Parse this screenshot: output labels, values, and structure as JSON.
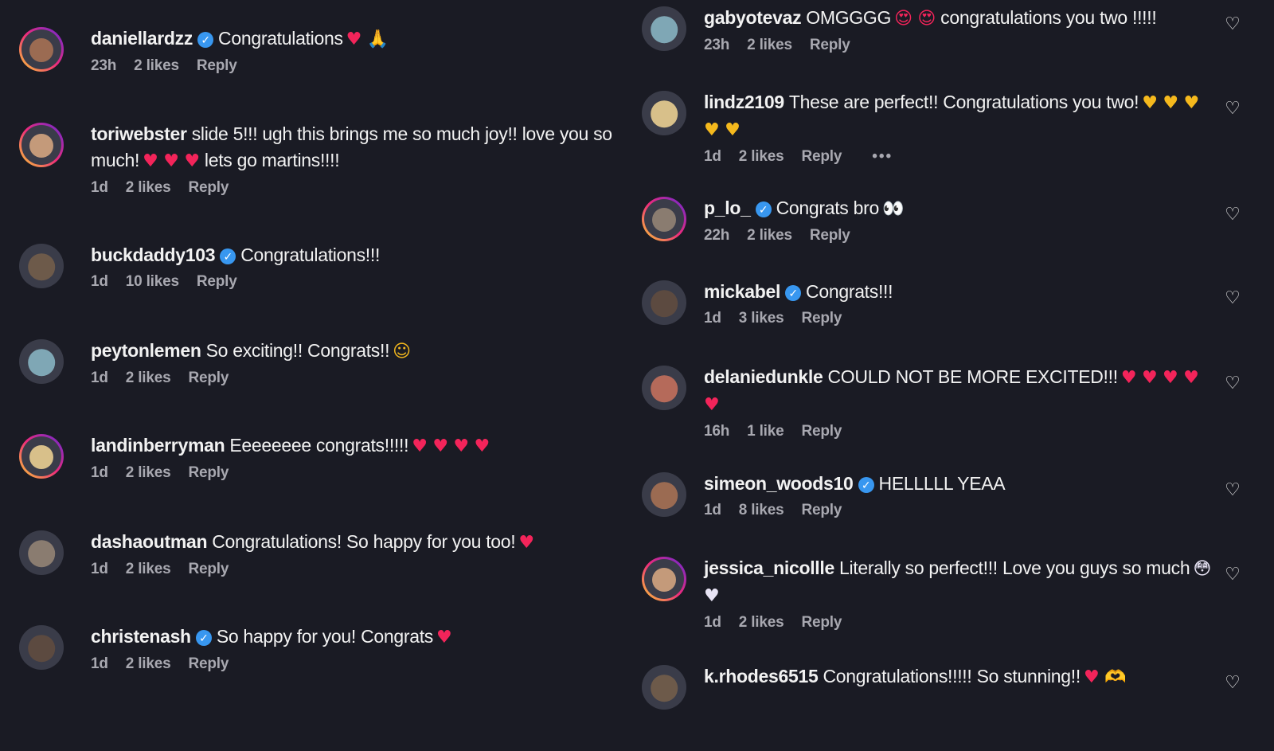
{
  "left": [
    {
      "user": "daniellardzz",
      "verified": true,
      "text": "Congratulations",
      "emoji": "♥ 🙏",
      "emoji_color": "red",
      "time": "23h",
      "likes": "2 likes",
      "reply": "Reply",
      "ring": true
    },
    {
      "user": "toriwebster",
      "verified": false,
      "text": "slide 5!!! ugh this brings me so much joy!! love you so much!",
      "emoji": "♥ ♥ ♥",
      "emoji_color": "red",
      "text2": "lets go martins!!!!",
      "time": "1d",
      "likes": "2 likes",
      "reply": "Reply",
      "ring": true
    },
    {
      "user": "buckdaddy103",
      "verified": true,
      "text": "Congratulations!!!",
      "emoji": "",
      "time": "1d",
      "likes": "10 likes",
      "reply": "Reply",
      "ring": false
    },
    {
      "user": "peytonlemen",
      "verified": false,
      "text": "So exciting!! Congrats!!",
      "emoji": "☺",
      "emoji_color": "yellow",
      "time": "1d",
      "likes": "2 likes",
      "reply": "Reply",
      "ring": false
    },
    {
      "user": "landinberryman",
      "verified": false,
      "text": "Eeeeeeee congrats!!!!!",
      "emoji": "♥ ♥ ♥ ♥",
      "emoji_color": "red",
      "time": "1d",
      "likes": "2 likes",
      "reply": "Reply",
      "ring": true
    },
    {
      "user": "dashaoutman",
      "verified": false,
      "text": "Congratulations! So happy for you too!",
      "emoji": "♥",
      "emoji_color": "red",
      "time": "1d",
      "likes": "2 likes",
      "reply": "Reply",
      "ring": false
    },
    {
      "user": "christenash",
      "verified": true,
      "text": "So happy for you! Congrats",
      "emoji": "♥",
      "emoji_color": "red",
      "time": "1d",
      "likes": "2 likes",
      "reply": "Reply",
      "ring": false
    }
  ],
  "right": [
    {
      "user": "gabyotevaz",
      "verified": false,
      "text": "OMGGGG",
      "emoji": "😍 😍",
      "emoji_color": "red",
      "text2": "congratulations you two !!!!!",
      "time": "23h",
      "likes": "2 likes",
      "reply": "Reply",
      "ring": false
    },
    {
      "user": "lindz2109",
      "verified": false,
      "text": "These are perfect!! Congratulations you two!",
      "emoji": "♥ ♥ ♥ ♥ ♥",
      "emoji_color": "yellow",
      "time": "1d",
      "likes": "2 likes",
      "reply": "Reply",
      "more": "•••",
      "ring": false
    },
    {
      "user": "p_lo_",
      "verified": true,
      "text": "Congrats bro",
      "emoji": "👀",
      "emoji_color": "white",
      "time": "22h",
      "likes": "2 likes",
      "reply": "Reply",
      "ring": true
    },
    {
      "user": "mickabel",
      "verified": true,
      "text": "Congrats!!!",
      "emoji": "",
      "time": "1d",
      "likes": "3 likes",
      "reply": "Reply",
      "ring": false
    },
    {
      "user": "delaniedunkle",
      "verified": false,
      "text": "COULD NOT BE MORE EXCITED!!!",
      "emoji": "♥ ♥ ♥ ♥ ♥",
      "emoji_color": "red",
      "time": "16h",
      "likes": "1 like",
      "reply": "Reply",
      "ring": false
    },
    {
      "user": "simeon_woods10",
      "verified": true,
      "text": "HELLLLL YEAA",
      "emoji": "",
      "time": "1d",
      "likes": "8 likes",
      "reply": "Reply",
      "ring": false
    },
    {
      "user": "jessica_nicollle",
      "verified": false,
      "text": "Literally so perfect!!! Love you guys so much",
      "emoji": "😳 ♥",
      "emoji_color": "white",
      "time": "1d",
      "likes": "2 likes",
      "reply": "Reply",
      "ring": true
    },
    {
      "user": "k.rhodes6515",
      "verified": false,
      "text": "Congratulations!!!!! So stunning!!",
      "emoji": "♥ 🫶",
      "emoji_color": "red",
      "time": "",
      "likes": "",
      "reply": "",
      "ring": false
    }
  ],
  "icons": {
    "verified": "✓",
    "heart": "♡"
  },
  "colors": {
    "background": "#1a1b24",
    "verified": "#3897f0",
    "heart_red": "#f3245a",
    "heart_yellow": "#f5b91d"
  }
}
